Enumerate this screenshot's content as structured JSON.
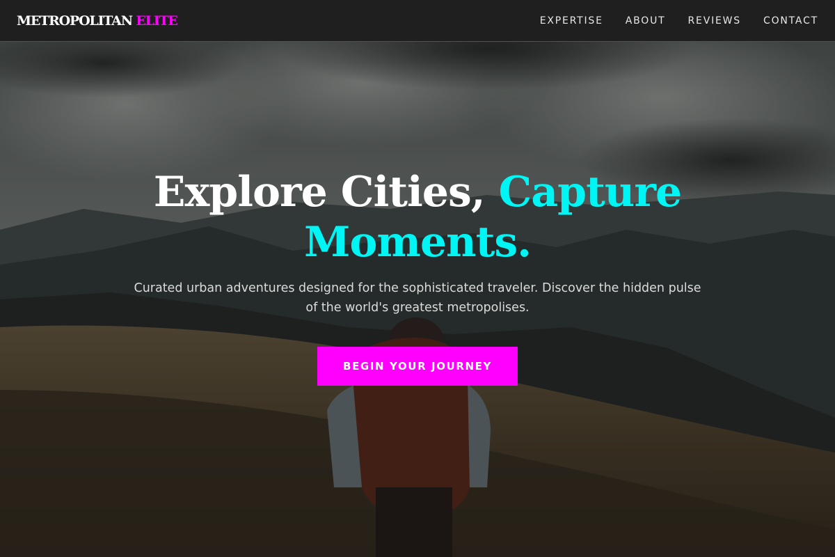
{
  "header": {
    "brand": {
      "main": "METROPOLITAN",
      "accent": "ELITE"
    },
    "nav": [
      {
        "label": "EXPERTISE"
      },
      {
        "label": "ABOUT"
      },
      {
        "label": "REVIEWS"
      },
      {
        "label": "CONTACT"
      }
    ]
  },
  "hero": {
    "title_white": "Explore Cities,",
    "title_accent_1": "Capture",
    "title_accent_2": "Moments.",
    "subtitle": "Curated urban adventures designed for the sophisticated traveler. Discover the hidden pulse of the world's greatest metropolises.",
    "cta": "BEGIN YOUR JOURNEY",
    "background_image": "mountain-hiker-photo"
  },
  "colors": {
    "accent_magenta": "#ff00ff",
    "accent_cyan": "#00f5f5",
    "navbar_bg": "#1f1f1f"
  }
}
